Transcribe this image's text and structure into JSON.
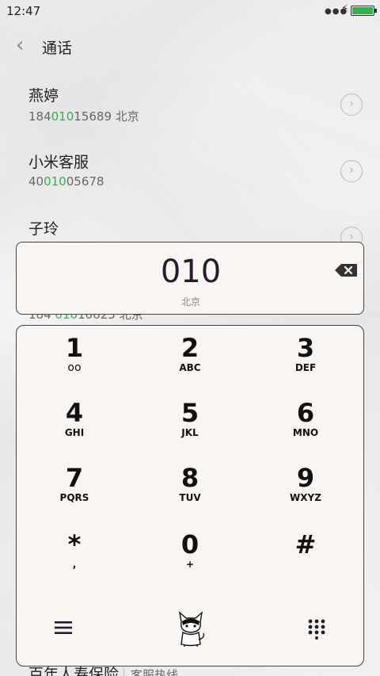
{
  "status_bar": {
    "time": "12:47",
    "battery_color": "#2fb34a"
  },
  "header": {
    "title": "通话"
  },
  "results": [
    {
      "name": "燕婷",
      "number_prefix": "184",
      "number_match": "010",
      "number_suffix": "15689",
      "location": "北京"
    },
    {
      "name": "小米客服",
      "number_prefix": "40",
      "number_match": "010",
      "number_suffix": "05678",
      "location": ""
    },
    {
      "name": "子玲",
      "number_prefix": "184",
      "number_match": "010",
      "number_suffix": "10625",
      "location": "北京"
    }
  ],
  "display": {
    "number": "010",
    "location": "北京"
  },
  "keypad": {
    "keys": [
      {
        "digit": "1",
        "letters": ""
      },
      {
        "digit": "2",
        "letters": "ABC"
      },
      {
        "digit": "3",
        "letters": "DEF"
      },
      {
        "digit": "4",
        "letters": "GHI"
      },
      {
        "digit": "5",
        "letters": "JKL"
      },
      {
        "digit": "6",
        "letters": "MNO"
      },
      {
        "digit": "7",
        "letters": "PQRS"
      },
      {
        "digit": "8",
        "letters": "TUV"
      },
      {
        "digit": "9",
        "letters": "WXYZ"
      },
      {
        "digit": "*",
        "letters": ","
      },
      {
        "digit": "0",
        "letters": "+"
      },
      {
        "digit": "#",
        "letters": ""
      }
    ]
  },
  "bottom_peek": {
    "name": "百年人寿保险",
    "sub": "客服热线"
  },
  "colors": {
    "accent": "#2fb34a",
    "card_bg": "#f8f5f2",
    "digit_color": "#2a1a2e"
  }
}
